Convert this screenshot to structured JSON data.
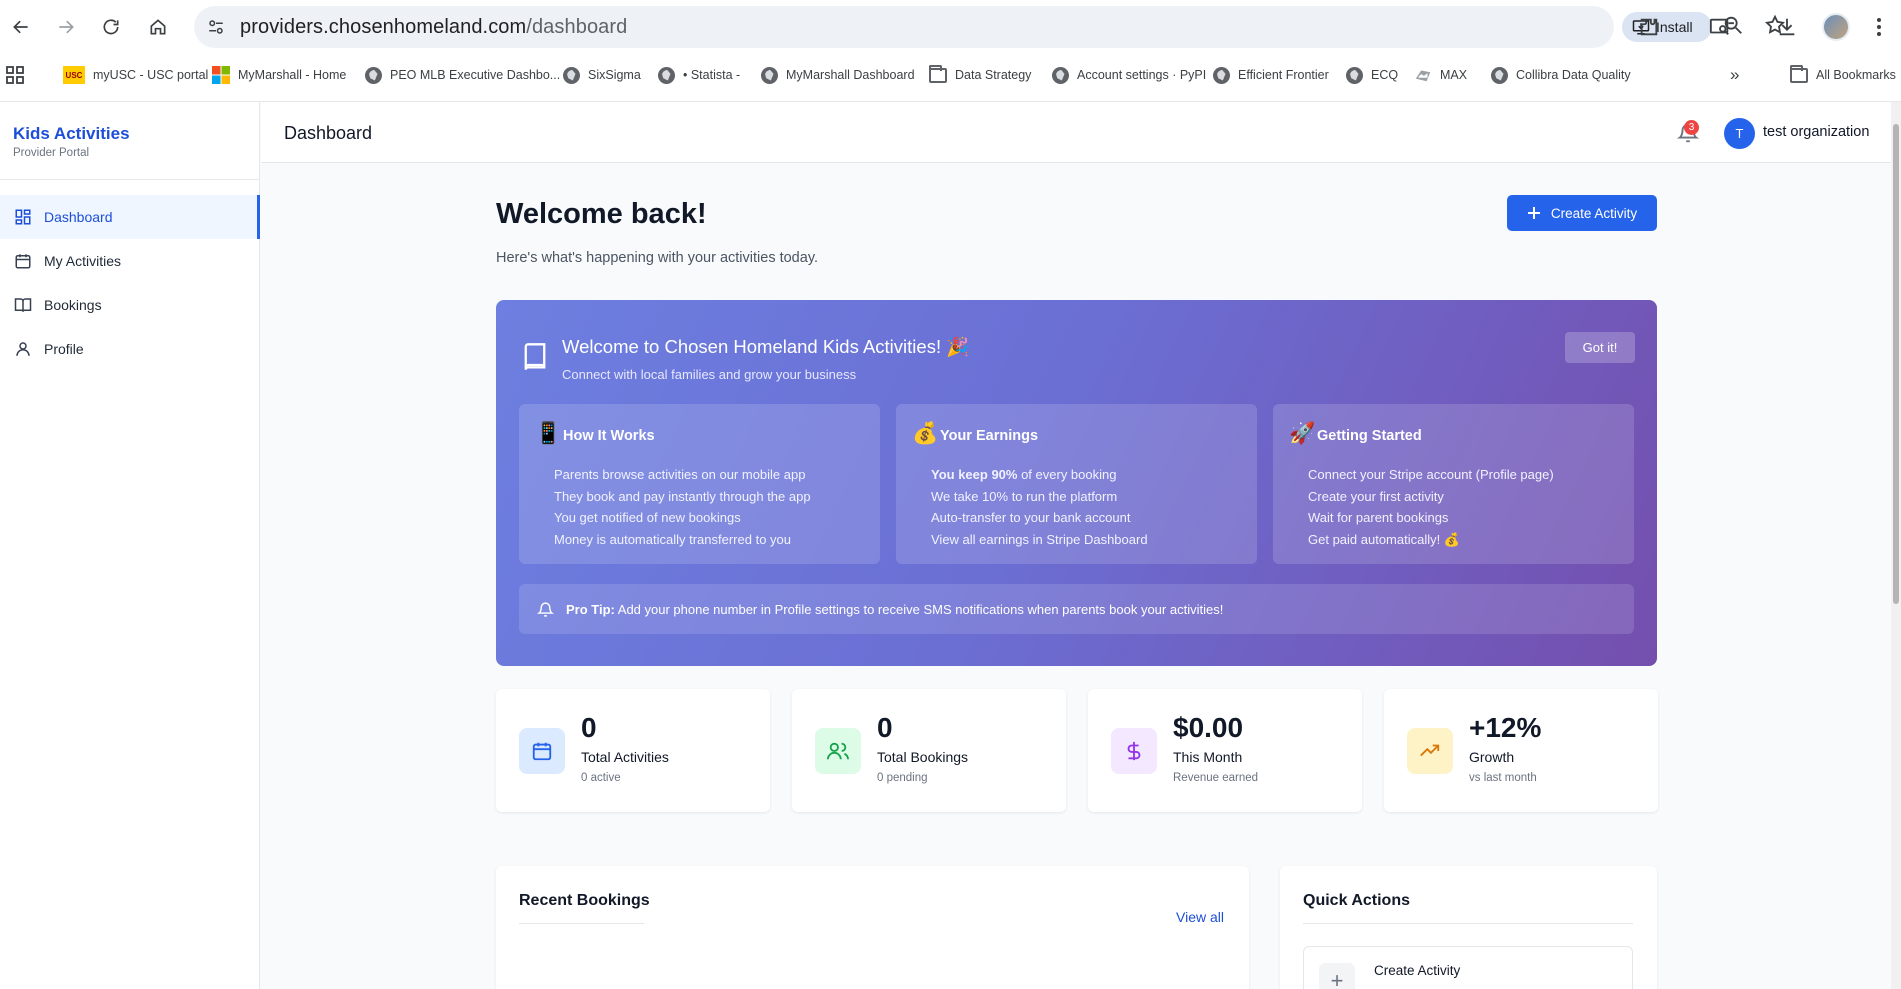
{
  "browser": {
    "url_host": "providers.chosenhomeland.com",
    "url_path": "/dashboard",
    "install_label": "Install",
    "bookmarks": [
      {
        "label": "myUSC - USC portal",
        "icon": "usc-logo"
      },
      {
        "label": "MyMarshall - Home",
        "icon": "microsoft-logo"
      },
      {
        "label": "PEO MLB Executive Dashbo...",
        "icon": "globe-icon"
      },
      {
        "label": "SixSigma",
        "icon": "globe-icon"
      },
      {
        "label": "• Statista -",
        "icon": "globe-icon"
      },
      {
        "label": "MyMarshall Dashboard",
        "icon": "globe-icon"
      },
      {
        "label": "Data Strategy",
        "icon": "folder-icon"
      },
      {
        "label": "Account settings · PyPI",
        "icon": "globe-icon"
      },
      {
        "label": "Efficient Frontier",
        "icon": "globe-icon"
      },
      {
        "label": "ECQ",
        "icon": "globe-icon"
      },
      {
        "label": "MAX",
        "icon": "image-icon"
      },
      {
        "label": "Collibra Data Quality",
        "icon": "globe-icon"
      }
    ],
    "all_bookmarks_label": "All Bookmarks"
  },
  "sidebar": {
    "brand_title": "Kids Activities",
    "brand_subtitle": "Provider Portal",
    "items": [
      {
        "label": "Dashboard",
        "icon": "grid-icon",
        "active": true
      },
      {
        "label": "My Activities",
        "icon": "calendar-icon",
        "active": false
      },
      {
        "label": "Bookings",
        "icon": "book-open-icon",
        "active": false
      },
      {
        "label": "Profile",
        "icon": "user-icon",
        "active": false
      }
    ]
  },
  "header": {
    "title": "Dashboard",
    "notification_count": "3",
    "org_initial": "T",
    "org_name": "test organization"
  },
  "main": {
    "welcome_title": "Welcome back!",
    "welcome_subtitle": "Here's what's happening with your activities today.",
    "create_button": "Create Activity"
  },
  "hero": {
    "title": "Welcome to Chosen Homeland Kids Activities! 🎉",
    "subtitle": "Connect with local families and grow your business",
    "dismiss_label": "Got it!",
    "cards": [
      {
        "emoji": "📱",
        "title": "How It Works",
        "items": [
          "Parents browse activities on our mobile app",
          "They book and pay instantly through the app",
          "You get notified of new bookings",
          "Money is automatically transferred to you"
        ]
      },
      {
        "emoji": "💰",
        "title": "Your Earnings",
        "items_bold_prefix": "You keep 90%",
        "items_first_rest": " of every booking",
        "items": [
          "We take 10% to run the platform",
          "Auto-transfer to your bank account",
          "View all earnings in Stripe Dashboard"
        ]
      },
      {
        "emoji": "🚀",
        "title": "Getting Started",
        "items": [
          "Connect your Stripe account (Profile page)",
          "Create your first activity",
          "Wait for parent bookings",
          "Get paid automatically! 💰"
        ]
      }
    ],
    "pro_tip_label": "Pro Tip:",
    "pro_tip_text": " Add your phone number in Profile settings to receive SMS notifications when parents book your activities!"
  },
  "stats": [
    {
      "value": "0",
      "label": "Total Activities",
      "sub": "0 active",
      "icon": "calendar-icon",
      "bg": "#dbeafe",
      "fg": "#2563eb"
    },
    {
      "value": "0",
      "label": "Total Bookings",
      "sub": "0 pending",
      "icon": "users-icon",
      "bg": "#dcfce7",
      "fg": "#16a34a"
    },
    {
      "value": "$0.00",
      "label": "This Month",
      "sub": "Revenue earned",
      "icon": "dollar-icon",
      "bg": "#f3e8ff",
      "fg": "#9333ea"
    },
    {
      "value": "+12%",
      "label": "Growth",
      "sub": "vs last month",
      "icon": "trending-up-icon",
      "bg": "#fef3c7",
      "fg": "#d97706"
    }
  ],
  "recent": {
    "title": "Recent Bookings",
    "view_all": "View all"
  },
  "quick_actions": {
    "title": "Quick Actions",
    "create_label": "Create Activity"
  }
}
